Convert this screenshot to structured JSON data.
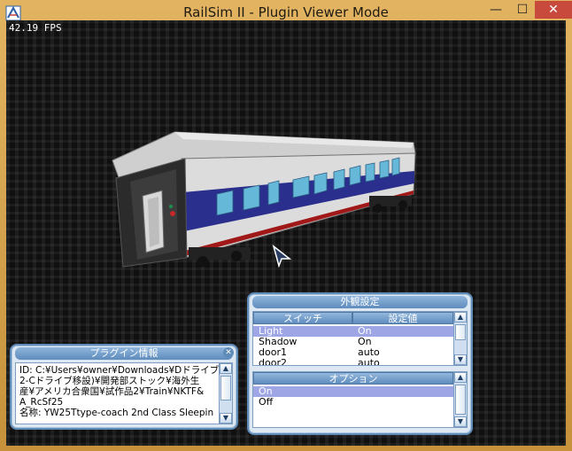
{
  "window": {
    "title": "RailSim II - Plugin Viewer Mode"
  },
  "controls": {
    "minimize": "—",
    "maximize": "☐",
    "close": "✕"
  },
  "viewport": {
    "fps": "42.19 FPS"
  },
  "appearance_panel": {
    "title": "外観設定",
    "switch_list": {
      "col_switch": "スイッチ",
      "col_value": "設定値",
      "rows": [
        {
          "name": "Light",
          "value": "On",
          "selected": true
        },
        {
          "name": "Shadow",
          "value": "On",
          "selected": false
        },
        {
          "name": "door1",
          "value": "auto",
          "selected": false
        },
        {
          "name": "door2",
          "value": "auto",
          "selected": false
        }
      ]
    },
    "options_list": {
      "header": "オプション",
      "rows": [
        {
          "label": "On",
          "selected": true
        },
        {
          "label": "Off",
          "selected": false
        }
      ]
    }
  },
  "plugin_info_panel": {
    "title": "プラグイン情報",
    "lines": [
      "ID: C:¥Users¥owner¥Downloads¥Dドライブ(",
      "2-Cドライブ移設)¥開発部ストック¥海外生",
      "産¥アメリカ合衆国¥試作品2¥Train¥NKTF&",
      "A_RcSf25",
      "名称: YW25Ttype-coach 2nd Class Sleepin"
    ]
  },
  "colors": {
    "panel_border": "#5e8bb8",
    "selection": "#9fa6e6",
    "frame": "#d6a34f"
  },
  "icons": {
    "app": "railsim-logo-icon",
    "cursor": "arrow-cursor-icon"
  }
}
